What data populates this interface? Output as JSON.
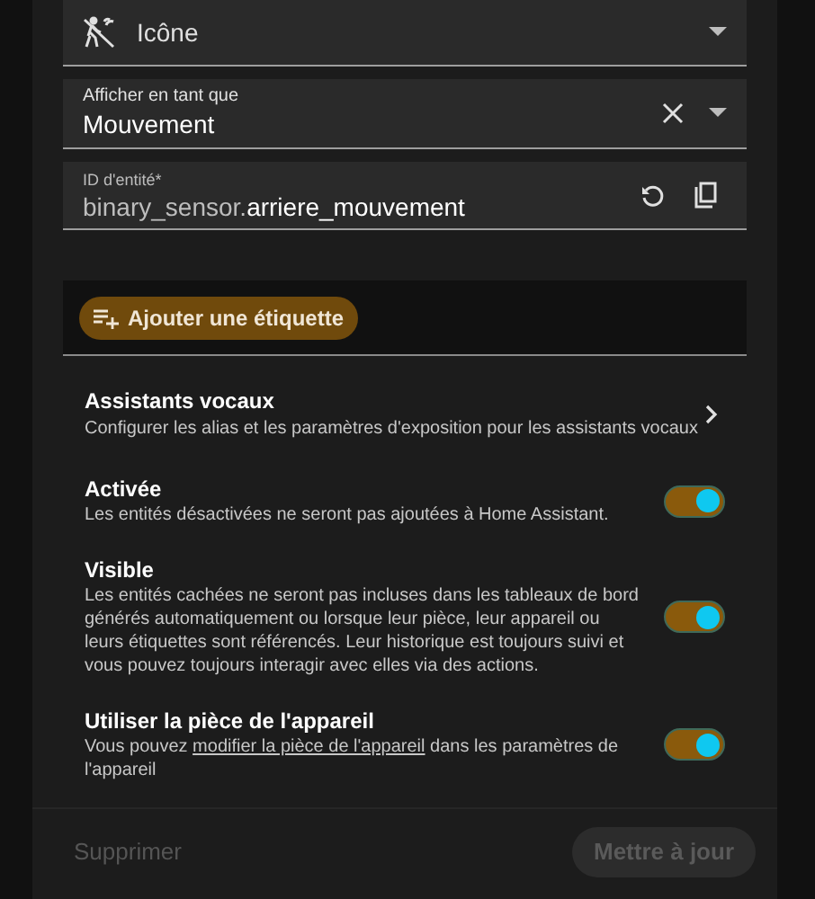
{
  "icon_field": {
    "value": "Icône"
  },
  "display_field": {
    "label": "Afficher en tant que",
    "value": "Mouvement"
  },
  "entity_id_field": {
    "label": "ID d'entité*",
    "prefix": "binary_sensor.",
    "value": "arriere_mouvement"
  },
  "add_label_button": "Ajouter une étiquette",
  "voice_assistants": {
    "title": "Assistants vocaux",
    "description": "Configurer les alias et les paramètres d'exposition pour les assistants vocaux"
  },
  "settings": [
    {
      "title": "Activée",
      "description": "Les entités désactivées ne seront pas ajoutées à Home Assistant.",
      "on": true
    },
    {
      "title": "Visible",
      "description": "Les entités cachées ne seront pas incluses dans les tableaux de bord générés automatiquement ou lorsque leur pièce, leur appareil ou leurs étiquettes sont référencés. Leur historique est toujours suivi et vous pouvez toujours interagir avec elles via des actions.",
      "on": true
    },
    {
      "title": "Utiliser la pièce de l'appareil",
      "description_before": "Vous pouvez ",
      "link": "modifier la pièce de l'appareil",
      "description_after": " dans les paramètres de l'appareil",
      "on": true
    }
  ],
  "footer": {
    "delete": "Supprimer",
    "update": "Mettre à jour",
    "update_disabled": true
  }
}
